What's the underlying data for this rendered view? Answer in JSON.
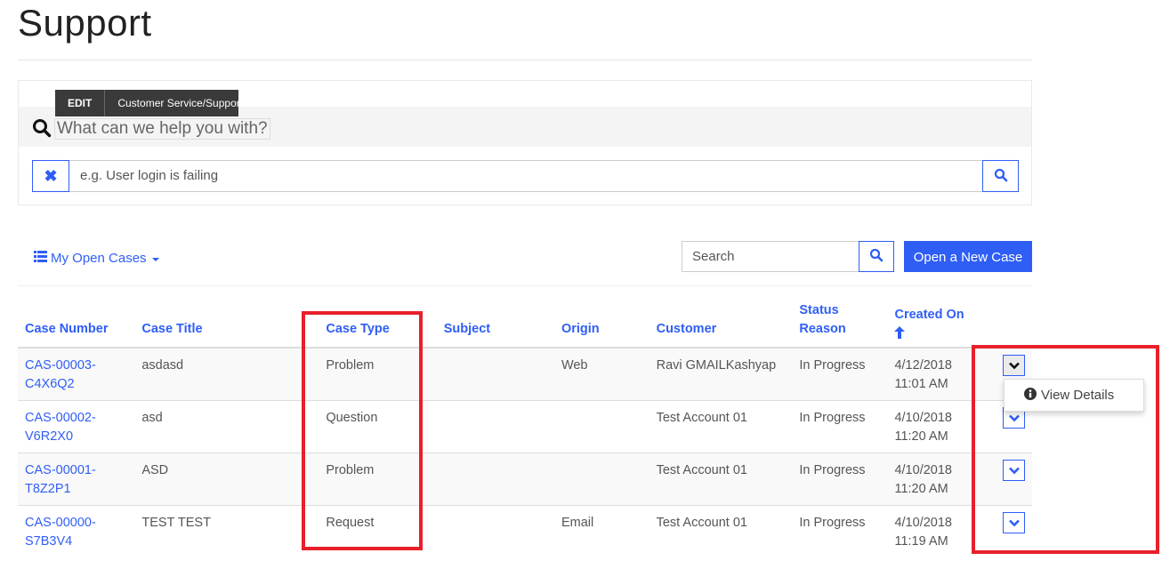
{
  "page": {
    "title": "Support"
  },
  "search_panel": {
    "edit_label": "EDIT",
    "edit_path": "Customer Service/Support",
    "heading": "What can we help you with?",
    "clear_icon": "close-icon",
    "input_placeholder": "e.g. User login is failing",
    "input_value": "",
    "search_icon": "search-icon"
  },
  "grid_toolbar": {
    "view_label": "My Open Cases",
    "view_icon": "list-icon",
    "search_placeholder": "Search",
    "new_case_label": "Open a New Case"
  },
  "colors": {
    "accent": "#2f5ef5",
    "highlight": "#e8202a"
  },
  "table": {
    "columns": [
      {
        "key": "case_number",
        "label": "Case Number"
      },
      {
        "key": "case_title",
        "label": "Case Title"
      },
      {
        "key": "case_type",
        "label": "Case Type"
      },
      {
        "key": "subject",
        "label": "Subject"
      },
      {
        "key": "origin",
        "label": "Origin"
      },
      {
        "key": "customer",
        "label": "Customer"
      },
      {
        "key": "status_reason",
        "label": "Status Reason"
      },
      {
        "key": "created_on",
        "label": "Created On",
        "sort": "ascending"
      }
    ],
    "rows": [
      {
        "case_number": "CAS-00003-C4X6Q2",
        "case_title": "asdasd",
        "case_type": "Problem",
        "subject": "",
        "origin": "Web",
        "customer": "Ravi GMAILKashyap",
        "status_reason": "In Progress",
        "created_on": "4/12/2018 11:01 AM"
      },
      {
        "case_number": "CAS-00002-V6R2X0",
        "case_title": "asd",
        "case_type": "Question",
        "subject": "",
        "origin": "",
        "customer": "Test Account 01",
        "status_reason": "In Progress",
        "created_on": "4/10/2018 11:20 AM"
      },
      {
        "case_number": "CAS-00001-T8Z2P1",
        "case_title": "ASD",
        "case_type": "Problem",
        "subject": "",
        "origin": "",
        "customer": "Test Account 01",
        "status_reason": "In Progress",
        "created_on": "4/10/2018 11:20 AM"
      },
      {
        "case_number": "CAS-00000-S7B3V4",
        "case_title": "TEST TEST",
        "case_type": "Request",
        "subject": "",
        "origin": "Email",
        "customer": "Test Account 01",
        "status_reason": "In Progress",
        "created_on": "4/10/2018 11:19 AM"
      }
    ]
  },
  "row_menu": {
    "open_row": 0,
    "items": [
      {
        "label": "View Details",
        "icon": "info-icon"
      }
    ]
  }
}
